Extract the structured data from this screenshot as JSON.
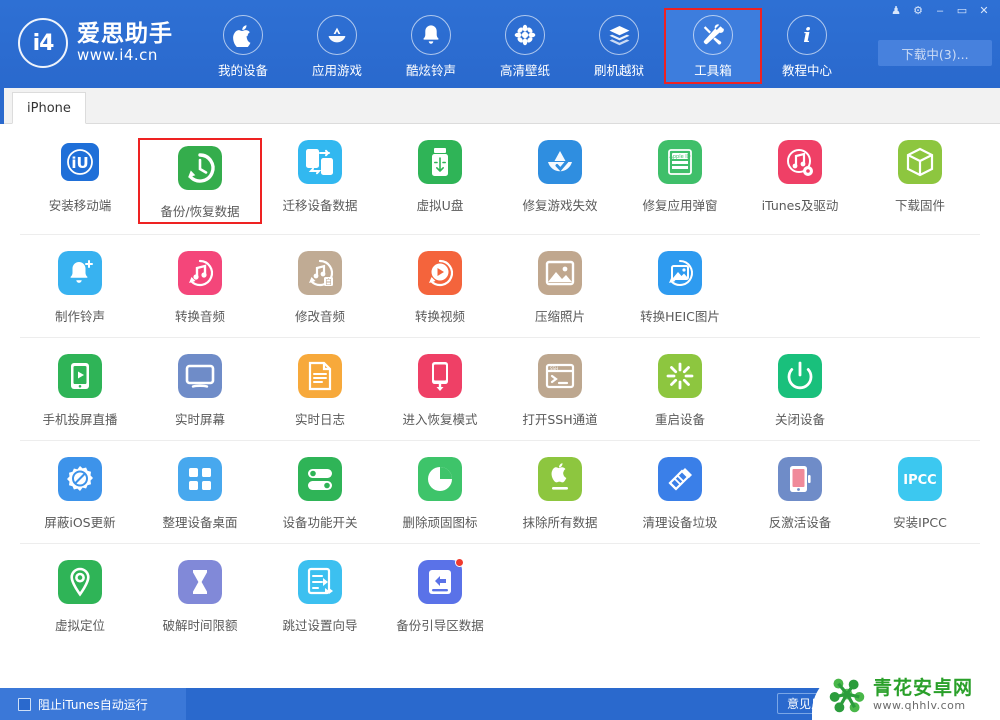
{
  "header": {
    "brand_name": "爱思助手",
    "brand_url": "www.i4.cn",
    "logo_glyph": "i4",
    "accent": "#2a69cd",
    "nav": [
      {
        "label": "我的设备",
        "icon": "apple-icon",
        "active": false,
        "highlight": false
      },
      {
        "label": "应用游戏",
        "icon": "appstore-icon",
        "active": false,
        "highlight": false
      },
      {
        "label": "酷炫铃声",
        "icon": "bell-icon",
        "active": false,
        "highlight": false
      },
      {
        "label": "高清壁纸",
        "icon": "flower-wallpaper-icon",
        "active": false,
        "highlight": false
      },
      {
        "label": "刷机越狱",
        "icon": "flash-box-icon",
        "active": false,
        "highlight": false
      },
      {
        "label": "工具箱",
        "icon": "toolbox-wrench-icon",
        "active": true,
        "highlight": true
      },
      {
        "label": "教程中心",
        "icon": "info-icon",
        "active": false,
        "highlight": false
      }
    ],
    "window_controls": [
      {
        "name": "skin-shirt-icon",
        "glyph": "♟"
      },
      {
        "name": "gear-icon",
        "glyph": "⚙"
      },
      {
        "name": "minimize-icon",
        "glyph": "–"
      },
      {
        "name": "maximize-icon",
        "glyph": "▭"
      },
      {
        "name": "close-icon",
        "glyph": "✕"
      }
    ],
    "download_button": "下载中(3)..."
  },
  "tabs": [
    {
      "label": "iPhone",
      "active": true
    }
  ],
  "tool_rows": [
    [
      {
        "label": "安装移动端",
        "icon": "i4-app-icon",
        "color": "#ffffff",
        "highlight": false,
        "badge": false
      },
      {
        "label": "备份/恢复数据",
        "icon": "backup-restore-icon",
        "color": "#34ad4c",
        "highlight": true,
        "badge": false
      },
      {
        "label": "迁移设备数据",
        "icon": "migrate-device-icon",
        "color": "#32b8f0",
        "highlight": false,
        "badge": false
      },
      {
        "label": "虚拟U盘",
        "icon": "usb-drive-icon",
        "color": "#2fb457",
        "highlight": false,
        "badge": false
      },
      {
        "label": "修复游戏失效",
        "icon": "fix-game-icon",
        "color": "#2f8ee0",
        "highlight": false,
        "badge": false
      },
      {
        "label": "修复应用弹窗",
        "icon": "apple-id-popup-icon",
        "color": "#3fbf6a",
        "highlight": false,
        "badge": false
      },
      {
        "label": "iTunes及驱动",
        "icon": "itunes-driver-icon",
        "color": "#ef4066",
        "highlight": false,
        "badge": false
      },
      {
        "label": "下载固件",
        "icon": "firmware-cube-icon",
        "color": "#8dc63f",
        "highlight": false,
        "badge": false
      }
    ],
    [
      {
        "label": "制作铃声",
        "icon": "make-ringtone-icon",
        "color": "#38b2f0",
        "highlight": false,
        "badge": false
      },
      {
        "label": "转换音频",
        "icon": "convert-audio-icon",
        "color": "#f4467a",
        "highlight": false,
        "badge": false
      },
      {
        "label": "修改音频",
        "icon": "edit-audio-icon",
        "color": "#c0ab94",
        "highlight": false,
        "badge": false
      },
      {
        "label": "转换视频",
        "icon": "convert-video-icon",
        "color": "#f4643c",
        "highlight": false,
        "badge": false
      },
      {
        "label": "压缩照片",
        "icon": "compress-photo-icon",
        "color": "#c0a78e",
        "highlight": false,
        "badge": false
      },
      {
        "label": "转换HEIC图片",
        "icon": "convert-heic-icon",
        "color": "#2e9bf0",
        "highlight": false,
        "badge": false
      }
    ],
    [
      {
        "label": "手机投屏直播",
        "icon": "screen-cast-live-icon",
        "color": "#2fb457",
        "highlight": false,
        "badge": false
      },
      {
        "label": "实时屏幕",
        "icon": "realtime-screen-icon",
        "color": "#6f8cc8",
        "highlight": false,
        "badge": false
      },
      {
        "label": "实时日志",
        "icon": "realtime-log-icon",
        "color": "#f7a93b",
        "highlight": false,
        "badge": false
      },
      {
        "label": "进入恢复模式",
        "icon": "recovery-mode-icon",
        "color": "#ef4066",
        "highlight": false,
        "badge": false
      },
      {
        "label": "打开SSH通道",
        "icon": "ssh-terminal-icon",
        "color": "#bda78f",
        "highlight": false,
        "badge": false
      },
      {
        "label": "重启设备",
        "icon": "reboot-device-icon",
        "color": "#8dc63f",
        "highlight": false,
        "badge": false
      },
      {
        "label": "关闭设备",
        "icon": "shutdown-device-icon",
        "color": "#19c07c",
        "highlight": false,
        "badge": false
      }
    ],
    [
      {
        "label": "屏蔽iOS更新",
        "icon": "block-ios-update-icon",
        "color": "#3d93ea",
        "highlight": false,
        "badge": false
      },
      {
        "label": "整理设备桌面",
        "icon": "organize-desktop-icon",
        "color": "#47a8ee",
        "highlight": false,
        "badge": false
      },
      {
        "label": "设备功能开关",
        "icon": "feature-toggle-icon",
        "color": "#2fb457",
        "highlight": false,
        "badge": false
      },
      {
        "label": "删除顽固图标",
        "icon": "delete-icon-pie-icon",
        "color": "#3ec46a",
        "highlight": false,
        "badge": false
      },
      {
        "label": "抹除所有数据",
        "icon": "erase-all-data-icon",
        "color": "#8dc63f",
        "highlight": false,
        "badge": false
      },
      {
        "label": "清理设备垃圾",
        "icon": "clean-junk-icon",
        "color": "#3a7fe8",
        "highlight": false,
        "badge": false
      },
      {
        "label": "反激活设备",
        "icon": "deactivate-device-icon",
        "color": "#6f8cc8",
        "highlight": false,
        "badge": false
      },
      {
        "label": "安装IPCC",
        "icon": "install-ipcc-icon",
        "color": "#3cc8f0",
        "highlight": false,
        "badge": false,
        "glyph": "IPCC"
      }
    ],
    [
      {
        "label": "虚拟定位",
        "icon": "virtual-location-icon",
        "color": "#2fb457",
        "highlight": false,
        "badge": false
      },
      {
        "label": "破解时间限额",
        "icon": "crack-time-limit-icon",
        "color": "#8189d8",
        "highlight": false,
        "badge": false
      },
      {
        "label": "跳过设置向导",
        "icon": "skip-setup-wizard-icon",
        "color": "#3cc0f0",
        "highlight": false,
        "badge": false
      },
      {
        "label": "备份引导区数据",
        "icon": "backup-boot-data-icon",
        "color": "#5a72e8",
        "highlight": false,
        "badge": true
      }
    ]
  ],
  "footer": {
    "checkbox_label": "阻止iTunes自动运行",
    "checkbox_checked": false,
    "feedback_label": "意见反馈"
  },
  "watermark": {
    "name": "青花安卓网",
    "url": "www.qhhlv.com"
  }
}
